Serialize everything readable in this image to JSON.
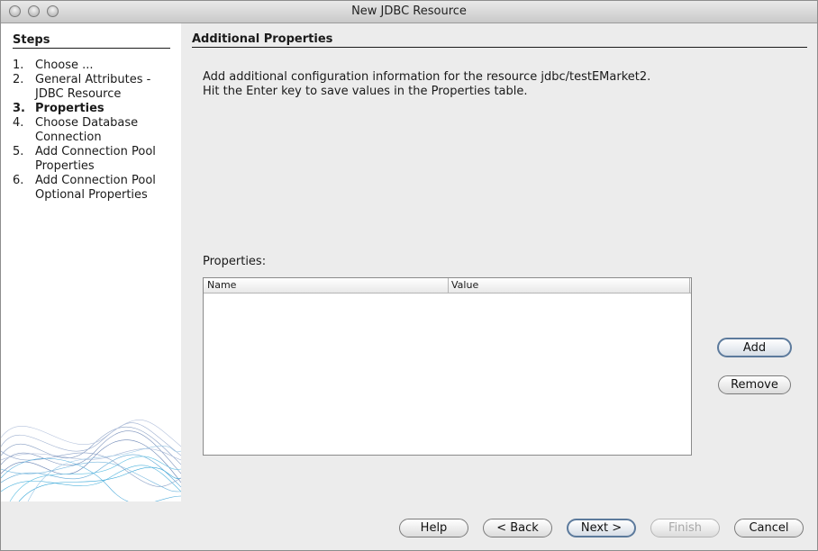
{
  "window": {
    "title": "New JDBC Resource"
  },
  "steps": {
    "heading": "Steps",
    "items": [
      {
        "num": "1.",
        "label": "Choose ...",
        "active": false
      },
      {
        "num": "2.",
        "label": "General Attributes -\nJDBC Resource",
        "active": false
      },
      {
        "num": "3.",
        "label": "Properties",
        "active": true
      },
      {
        "num": "4.",
        "label": "Choose Database\nConnection",
        "active": false
      },
      {
        "num": "5.",
        "label": "Add Connection Pool\nProperties",
        "active": false
      },
      {
        "num": "6.",
        "label": "Add Connection Pool\nOptional Properties",
        "active": false
      }
    ]
  },
  "main": {
    "heading": "Additional Properties",
    "description_line1": "Add additional configuration information for the resource jdbc/testEMarket2.",
    "description_line2": "Hit the Enter key to save values in the Properties table.",
    "properties_label": "Properties:",
    "table": {
      "columns": [
        "Name",
        "Value"
      ],
      "rows": []
    },
    "add_label": "Add",
    "remove_label": "Remove"
  },
  "footer": {
    "help_label": "Help",
    "back_label": "< Back",
    "next_label": "Next >",
    "finish_label": "Finish",
    "cancel_label": "Cancel"
  }
}
